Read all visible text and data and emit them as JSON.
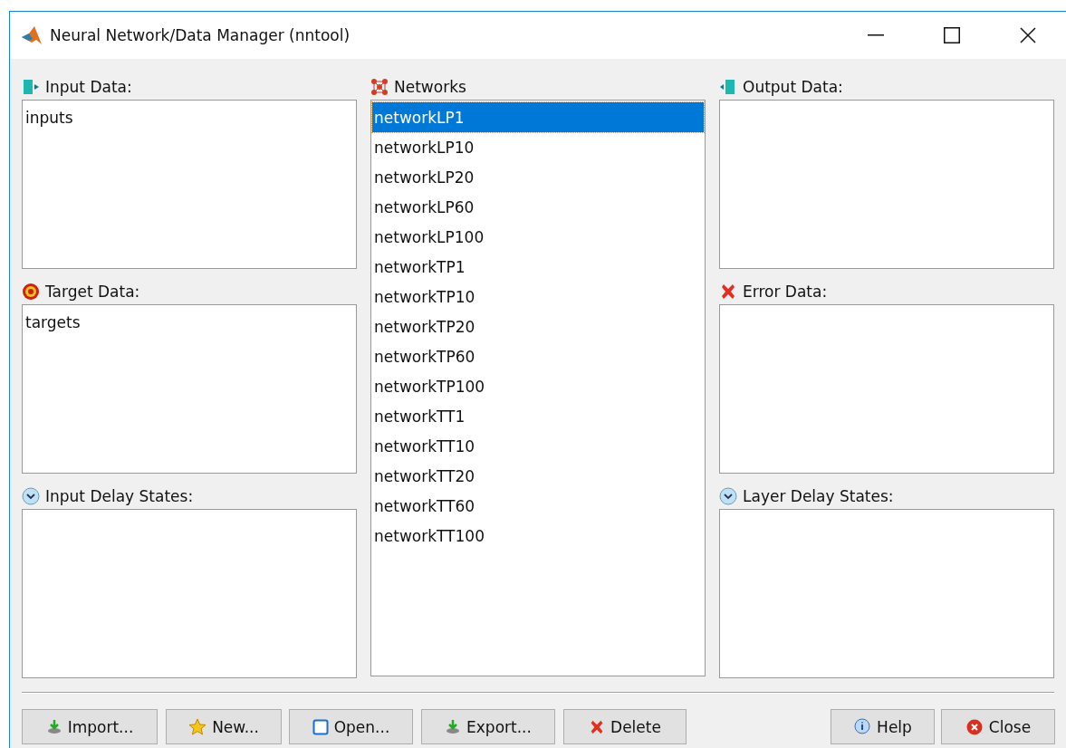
{
  "window": {
    "title": "Neural Network/Data Manager (nntool)"
  },
  "left_panels": [
    {
      "label": "Input Data:",
      "items": [
        {
          "label": "inputs",
          "selected": false
        }
      ]
    },
    {
      "label": "Target Data:",
      "items": [
        {
          "label": "targets",
          "selected": false
        }
      ]
    },
    {
      "label": "Input Delay States:"
    }
  ],
  "networks": {
    "label": "Networks",
    "items": [
      {
        "label": "networkLP1",
        "selected": true
      },
      {
        "label": "networkLP10",
        "selected": false
      },
      {
        "label": "networkLP20",
        "selected": false
      },
      {
        "label": "networkLP60",
        "selected": false
      },
      {
        "label": "networkLP100",
        "selected": false
      },
      {
        "label": "networkTP1",
        "selected": false
      },
      {
        "label": "networkTP10",
        "selected": false
      },
      {
        "label": "networkTP20",
        "selected": false
      },
      {
        "label": "networkTP60",
        "selected": false
      },
      {
        "label": "networkTP100",
        "selected": false
      },
      {
        "label": "networkTT1",
        "selected": false
      },
      {
        "label": "networkTT10",
        "selected": false
      },
      {
        "label": "networkTT20",
        "selected": false
      },
      {
        "label": "networkTT60",
        "selected": false
      },
      {
        "label": "networkTT100",
        "selected": false
      }
    ]
  },
  "right_panels": [
    {
      "label": "Output Data:"
    },
    {
      "label": "Error Data:"
    },
    {
      "label": "Layer Delay States:"
    }
  ],
  "buttons_left": [
    "Import...",
    "New...",
    "Open...",
    "Export...",
    "Delete"
  ],
  "buttons_right": [
    "Help",
    "Close"
  ]
}
